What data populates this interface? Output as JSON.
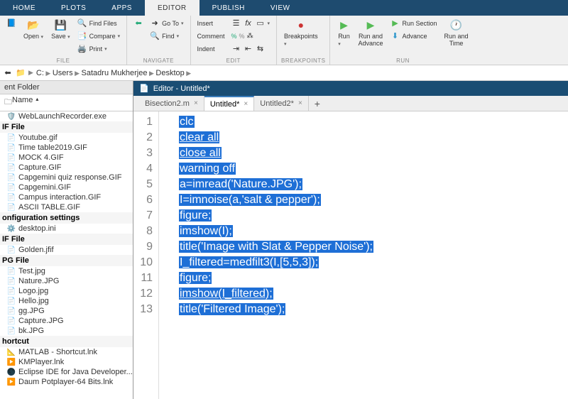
{
  "ribbon_tabs": [
    "HOME",
    "PLOTS",
    "APPS",
    "EDITOR",
    "PUBLISH",
    "VIEW"
  ],
  "active_ribbon": 3,
  "toolstrip": {
    "file": {
      "label": "FILE",
      "open": "Open",
      "save": "Save",
      "find_files": "Find Files",
      "compare": "Compare",
      "print": "Print"
    },
    "nav": {
      "label": "NAVIGATE",
      "go_to": "Go To",
      "find": "Find"
    },
    "edit": {
      "label": "EDIT",
      "insert": "Insert",
      "comment": "Comment",
      "indent": "Indent",
      "fx": "fx"
    },
    "bp": {
      "label": "BREAKPOINTS",
      "breakpoints": "Breakpoints"
    },
    "run": {
      "label": "RUN",
      "run": "Run",
      "run_advance": "Run and\nAdvance",
      "run_section": "Run Section",
      "advance": "Advance",
      "run_time": "Run and\nTime"
    }
  },
  "breadcrumb": [
    "C:",
    "Users",
    "Satadru Mukherjee",
    "Desktop"
  ],
  "folder_panel": {
    "title": "ent Folder",
    "header": "Name",
    "groups": [
      {
        "label": null,
        "items": [
          {
            "name": "WebLaunchRecorder.exe",
            "icon": "🛡️"
          }
        ]
      },
      {
        "label": "IF File",
        "items": [
          {
            "name": "Youtube.gif",
            "icon": "📄"
          },
          {
            "name": "Time table2019.GIF",
            "icon": "📄"
          },
          {
            "name": "MOCK 4.GIF",
            "icon": "📄"
          },
          {
            "name": "Capture.GIF",
            "icon": "📄"
          },
          {
            "name": "Capgemini quiz response.GIF",
            "icon": "📄"
          },
          {
            "name": "Capgemini.GIF",
            "icon": "📄"
          },
          {
            "name": "Campus interaction.GIF",
            "icon": "📄"
          },
          {
            "name": "ASCII TABLE.GIF",
            "icon": "📄"
          }
        ]
      },
      {
        "label": "onfiguration settings",
        "items": [
          {
            "name": "desktop.ini",
            "icon": "⚙️"
          }
        ]
      },
      {
        "label": "IF File",
        "items": [
          {
            "name": "Golden.jfif",
            "icon": "📄"
          }
        ]
      },
      {
        "label": "PG File",
        "items": [
          {
            "name": "Test.jpg",
            "icon": "📄"
          },
          {
            "name": "Nature.JPG",
            "icon": "📄"
          },
          {
            "name": "Logo.jpg",
            "icon": "📄"
          },
          {
            "name": "Hello.jpg",
            "icon": "📄"
          },
          {
            "name": "gg.JPG",
            "icon": "📄"
          },
          {
            "name": "Capture.JPG",
            "icon": "📄"
          },
          {
            "name": "bk.JPG",
            "icon": "📄"
          }
        ]
      },
      {
        "label": "hortcut",
        "items": [
          {
            "name": "MATLAB - Shortcut.lnk",
            "icon": "📐"
          },
          {
            "name": "KMPlayer.lnk",
            "icon": "▶️"
          },
          {
            "name": "Eclipse IDE for Java Developer...",
            "icon": "🌑"
          },
          {
            "name": "Daum Potplayer-64 Bits.lnk",
            "icon": "▶️"
          }
        ]
      }
    ]
  },
  "editor": {
    "title": "Editor - Untitled*",
    "tabs": [
      {
        "name": "Bisection2.m",
        "active": false,
        "dirty": false
      },
      {
        "name": "Untitled*",
        "active": true,
        "dirty": true
      },
      {
        "name": "Untitled2*",
        "active": false,
        "dirty": true
      }
    ],
    "code": [
      "clc",
      "clear all",
      "close all",
      "warning off",
      "a=imread('Nature.JPG');",
      "I=imnoise(a,'salt & pepper');",
      "figure;",
      "imshow(I);",
      "title('Image with Slat & Pepper Noise');",
      "I_filtered=medfilt3(I,[5,5,3]);",
      "figure;",
      "imshow(I_filtered);",
      "title('Filtered Image');"
    ],
    "underline_lines": [
      1,
      2,
      11
    ]
  }
}
